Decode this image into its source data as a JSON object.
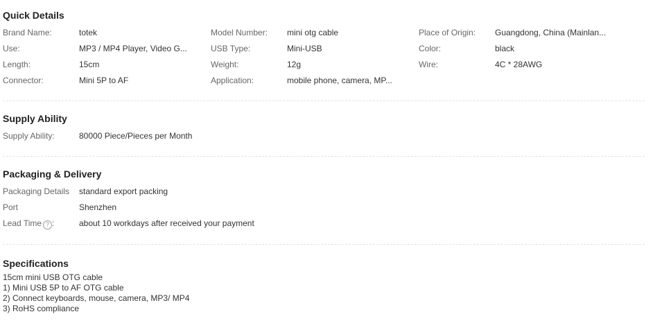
{
  "quick_details": {
    "title": "Quick Details",
    "rows": [
      [
        {
          "label": "Brand Name:",
          "value": "totek"
        },
        {
          "label": "Model Number:",
          "value": "mini otg cable"
        },
        {
          "label": "Place of Origin:",
          "value": "Guangdong, China (Mainlan..."
        }
      ],
      [
        {
          "label": "Use:",
          "value": "MP3 / MP4 Player, Video G..."
        },
        {
          "label": "USB Type:",
          "value": "Mini-USB"
        },
        {
          "label": "Color:",
          "value": "black"
        }
      ],
      [
        {
          "label": "Length:",
          "value": "15cm"
        },
        {
          "label": "Weight:",
          "value": "12g"
        },
        {
          "label": "Wire:",
          "value": "4C * 28AWG"
        }
      ],
      [
        {
          "label": "Connector:",
          "value": "Mini 5P to AF"
        },
        {
          "label": "Application:",
          "value": "mobile phone, camera, MP..."
        },
        {
          "label": "",
          "value": ""
        }
      ]
    ]
  },
  "supply": {
    "title": "Supply Ability",
    "label": "Supply Ability:",
    "value": "80000 Piece/Pieces per Month"
  },
  "packaging": {
    "title": "Packaging & Delivery",
    "details_label": "Packaging Details",
    "details_value": "standard export packing",
    "port_label": "Port",
    "port_value": "Shenzhen",
    "lead_label": "Lead Time",
    "lead_suffix": ":",
    "help_glyph": "?",
    "lead_value": "about 10 workdays after received your payment"
  },
  "specifications": {
    "title": "Specifications",
    "lines": [
      "15cm mini USB OTG cable",
      "1) Mini USB 5P to AF OTG cable",
      "2) Connect keyboards, mouse, camera, MP3/ MP4",
      "3) RoHS compliance"
    ]
  }
}
